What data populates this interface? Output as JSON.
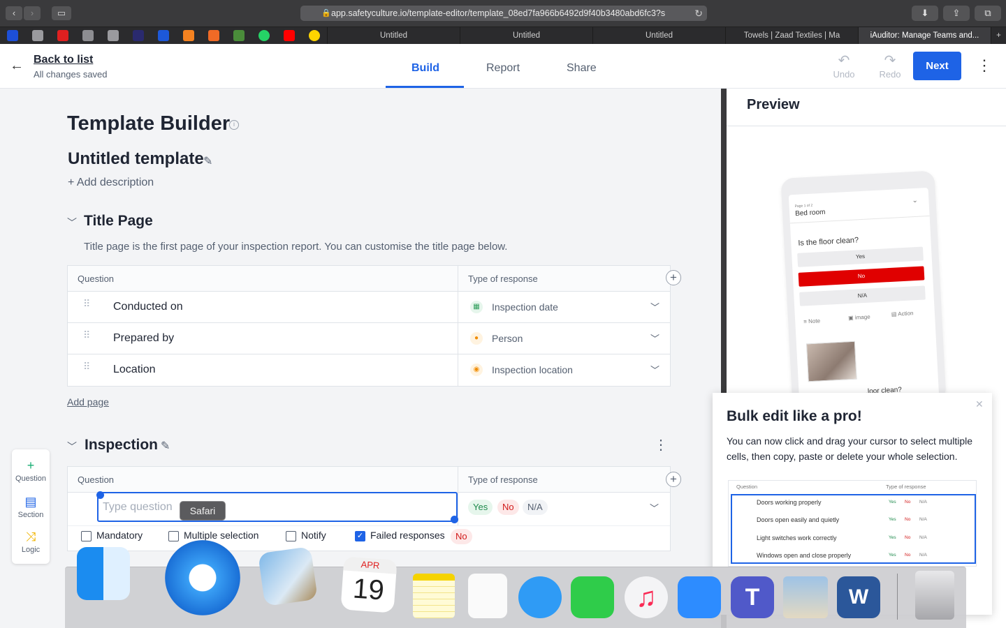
{
  "browser": {
    "url": "app.safetyculture.io/template-editor/template_08ed7fa966b6492d9f40b3480abd6fc3?s",
    "tabs": [
      {
        "label": "Untitled",
        "active": false
      },
      {
        "label": "Untitled",
        "active": false
      },
      {
        "label": "Untitled",
        "active": false
      },
      {
        "label": "Towels | Zaad Textiles | Ma",
        "active": false
      },
      {
        "label": "iAuditor: Manage Teams and...",
        "active": true
      }
    ]
  },
  "header": {
    "back_label": "Back to list",
    "status": "All changes saved",
    "tabs": [
      "Build",
      "Report",
      "Share"
    ],
    "active_tab": "Build",
    "undo_label": "Undo",
    "redo_label": "Redo",
    "next_label": "Next"
  },
  "editor": {
    "title": "Template Builder",
    "template_name": "Untitled template",
    "add_description": "+ Add description",
    "title_page": {
      "title": "Title Page",
      "description": "Title page is the first page of your inspection report. You can customise the title page below.",
      "col_question": "Question",
      "col_response": "Type of response",
      "rows": [
        {
          "question": "Conducted on",
          "response": "Inspection date",
          "icon": "calendar-icon"
        },
        {
          "question": "Prepared by",
          "response": "Person",
          "icon": "person-icon"
        },
        {
          "question": "Location",
          "response": "Inspection location",
          "icon": "location-pin-icon"
        }
      ]
    },
    "add_page": "Add page",
    "inspection": {
      "title": "Inspection",
      "col_question": "Question",
      "col_response": "Type of response",
      "question_placeholder": "Type question",
      "responses": [
        "Yes",
        "No",
        "N/A"
      ],
      "options": [
        {
          "label": "Mandatory",
          "checked": false
        },
        {
          "label": "Multiple selection",
          "checked": false
        },
        {
          "label": "Notify",
          "checked": false
        },
        {
          "label": "Failed responses",
          "checked": true
        }
      ],
      "failed_response_value": "No"
    },
    "tools": [
      "Question",
      "Section",
      "Logic"
    ]
  },
  "preview": {
    "title": "Preview",
    "phone": {
      "page_counter": "Page 1 of 2",
      "page_name": "Bed room",
      "question": "Is the floor clean?",
      "buttons": [
        "Yes",
        "No",
        "N/A"
      ],
      "actions": [
        "Note",
        "image",
        "Action"
      ],
      "next_question": "...loor clean?"
    }
  },
  "popup": {
    "title": "Bulk edit like a pro!",
    "body": "You can now click and drag your cursor to select multiple cells, then copy, paste or delete your whole selection.",
    "table": {
      "col_question": "Question",
      "col_response": "Type of response",
      "rows": [
        "Doors working properly",
        "Doors open easily and quietly",
        "Light switches work correctly",
        "Windows open and close properly"
      ],
      "chips": [
        "Yes",
        "No",
        "N/A"
      ]
    }
  },
  "dock": {
    "tooltip": "Safari",
    "calendar_month": "APR",
    "calendar_day": "19"
  },
  "colors": {
    "accent": "#1e63e6",
    "danger": "#e00000",
    "yes_bg": "#e6f6ec",
    "no_bg": "#fde8e8"
  }
}
